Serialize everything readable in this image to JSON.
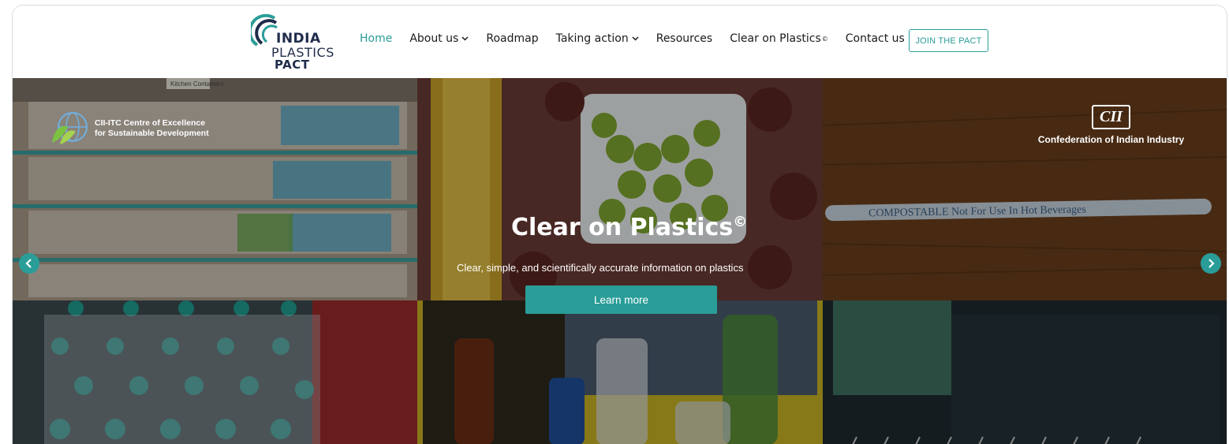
{
  "logo": {
    "line1": "INDIA",
    "line2": "PLASTICS",
    "line3": "PACT"
  },
  "nav": {
    "home": "Home",
    "about": "About us",
    "roadmap": "Roadmap",
    "taking_action": "Taking action",
    "resources": "Resources",
    "clear_on_plastics": "Clear on Plastics",
    "clear_mark": "©",
    "contact": "Contact us",
    "join": "JOIN THE PACT"
  },
  "hero": {
    "title": "Clear on Plastics",
    "title_mark": "©",
    "subtitle": "Clear, simple, and scientifically accurate information on plastics",
    "button": "Learn more"
  },
  "partners": {
    "cii_itc_line1": "CII-ITC Centre of Excellence",
    "cii_itc_line2": "for Sustainable Development",
    "cii_mark": "CII",
    "cii_caption": "Confederation of Indian Industry"
  },
  "photo_text": {
    "compostable": "COMPOSTABLE  Not For Use In Hot Beverages",
    "kitchen_sign": "Kitchen Containers"
  },
  "colors": {
    "accent": "#2a9d98",
    "navy": "#1f2b4a"
  }
}
